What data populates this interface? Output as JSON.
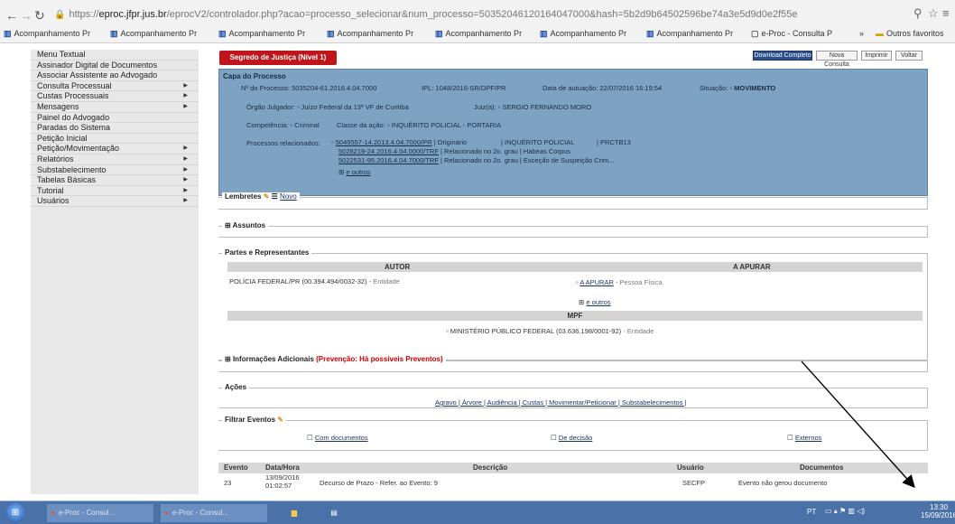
{
  "browser": {
    "url_prefix": "https://",
    "url_host": "eproc.jfpr.jus.br",
    "url_rest": "/eprocV2/controlador.php?acao=processo_selecionar&num_processo=50352046120164047000&hash=5b2d9b64502596be74a3e5d9d0e2f55e",
    "bookmarks": [
      "Acompanhamento Pr",
      "Acompanhamento Pr",
      "Acompanhamento Pr",
      "Acompanhamento Pr",
      "Acompanhamento Pr",
      "Acompanhamento Pr",
      "Acompanhamento Pr",
      "e-Proc - Consulta P",
      "»",
      "Outros favoritos"
    ]
  },
  "sidebar": {
    "items": [
      {
        "label": "Menu Textual",
        "arrow": ""
      },
      {
        "label": "Assinador Digital de Documentos",
        "arrow": ""
      },
      {
        "label": "Associar Assistente ao Advogado",
        "arrow": ""
      },
      {
        "label": "Consulta Processual",
        "arrow": "▶"
      },
      {
        "label": "Custas Processuais",
        "arrow": "▶"
      },
      {
        "label": "Mensagens",
        "arrow": "▶"
      },
      {
        "label": "Painel do Advogado",
        "arrow": ""
      },
      {
        "label": "Paradas do Sistema",
        "arrow": ""
      },
      {
        "label": "Petição Inicial",
        "arrow": ""
      },
      {
        "label": "Petição/Movimentação",
        "arrow": "▶"
      },
      {
        "label": "Relatórios",
        "arrow": "▶"
      },
      {
        "label": "Substabelecimento",
        "arrow": "▶"
      },
      {
        "label": "Tabelas Básicas",
        "arrow": "▶"
      },
      {
        "label": "Tutorial",
        "arrow": "▶"
      },
      {
        "label": "Usuários",
        "arrow": "▶"
      }
    ]
  },
  "top": {
    "secret_badge": "Segredo de Justiça (Nível 1)",
    "buttons": [
      "Download Completo",
      "Nova Consulta",
      "Imprimir",
      "Voltar"
    ]
  },
  "capa": {
    "title": "Capa do Processo",
    "num_label": "Nº do Processo:",
    "num_value": "5035204-61.2016.4.04.7000",
    "ipl_label": "IPL:",
    "ipl_value": "1048/2016-SR/DPF/PR",
    "autuacao_label": "Data de autuação:",
    "autuacao_value": "22/07/2016 16:19:54",
    "situacao_label": "Situação:",
    "situacao_value": "MOVIMENTO",
    "orgao_label": "Órgão Julgador:",
    "orgao_value": "Juízo Federal da 13ª VF de Curitiba",
    "juiz_label": "Juiz(a):",
    "juiz_value": "SERGIO FERNANDO MORO",
    "competencia_label": "Competência:",
    "competencia_value": "Criminal",
    "classe_label": "Classe da ação:",
    "classe_value": "INQUÉRITO POLICIAL - PORTARIA",
    "rel_label": "Processos relacionados:",
    "related": [
      {
        "num": "5049557-14.2013.4.04.7000/PR",
        "desc": "| Originário",
        "classe": "| INQUÉRITO POLICIAL",
        "extra": "| PRCTB13"
      },
      {
        "num": "5028219-24.2016.4.04.0000/TRF",
        "desc": "| Relacionado no 2o. grau",
        "classe": "| Habeas Corpus",
        "extra": ""
      },
      {
        "num": "5022531-95.2016.4.04.7000/TRF",
        "desc": "| Relacionado no 2o. grau",
        "classe": "| Exceção de Suspeição Crim...",
        "extra": ""
      }
    ],
    "more": "e outros"
  },
  "lembretes": {
    "title": "Lembretes",
    "novo": "Novo"
  },
  "assuntos": {
    "title": "Assuntos"
  },
  "partes": {
    "title": "Partes e Representantes",
    "col_autor": "AUTOR",
    "col_apurar": "A APURAR",
    "autor": "POLÍCIA FEDERAL/PR  (00.394.494/0032-32)",
    "autor_tipo": "- Entidade",
    "apurar": "A APURAR",
    "apurar_tipo": "- Pessoa Física",
    "outros": "e outros",
    "mpf_label": "MPF",
    "mpf": "MINISTÉRIO PÚBLICO FEDERAL  (03.636.198/0001-92)",
    "mpf_tipo": "- Entidade"
  },
  "info": {
    "title": "Informações Adicionais",
    "warning": "(Prevenção: Há possíveis Preventos)"
  },
  "acoes": {
    "title": "Ações",
    "links": "Agravo | Árvore | Audiência | Custas | Movimentar/Peticionar | Substabelecimentos |"
  },
  "filtrar": {
    "title": "Filtrar Eventos",
    "opt1": "Com documentos",
    "opt2": "De decisão",
    "opt3": "Externos"
  },
  "eventos": {
    "headers": [
      "Evento",
      "Data/Hora",
      "Descrição",
      "Usuário",
      "Documentos"
    ],
    "rows": [
      {
        "evento": "23",
        "data": "13/09/2016",
        "hora": "01:02:57",
        "descricao": "Decurso de Prazo - Refer. ao Evento: 9",
        "usuario": "SECFP",
        "documentos": "Evento não gerou documento"
      }
    ]
  },
  "taskbar": {
    "items": [
      "e-Proc - Consul...",
      "e-Proc - Consul..."
    ],
    "lang": "PT",
    "time": "13:30",
    "date": "15/09/2016"
  }
}
